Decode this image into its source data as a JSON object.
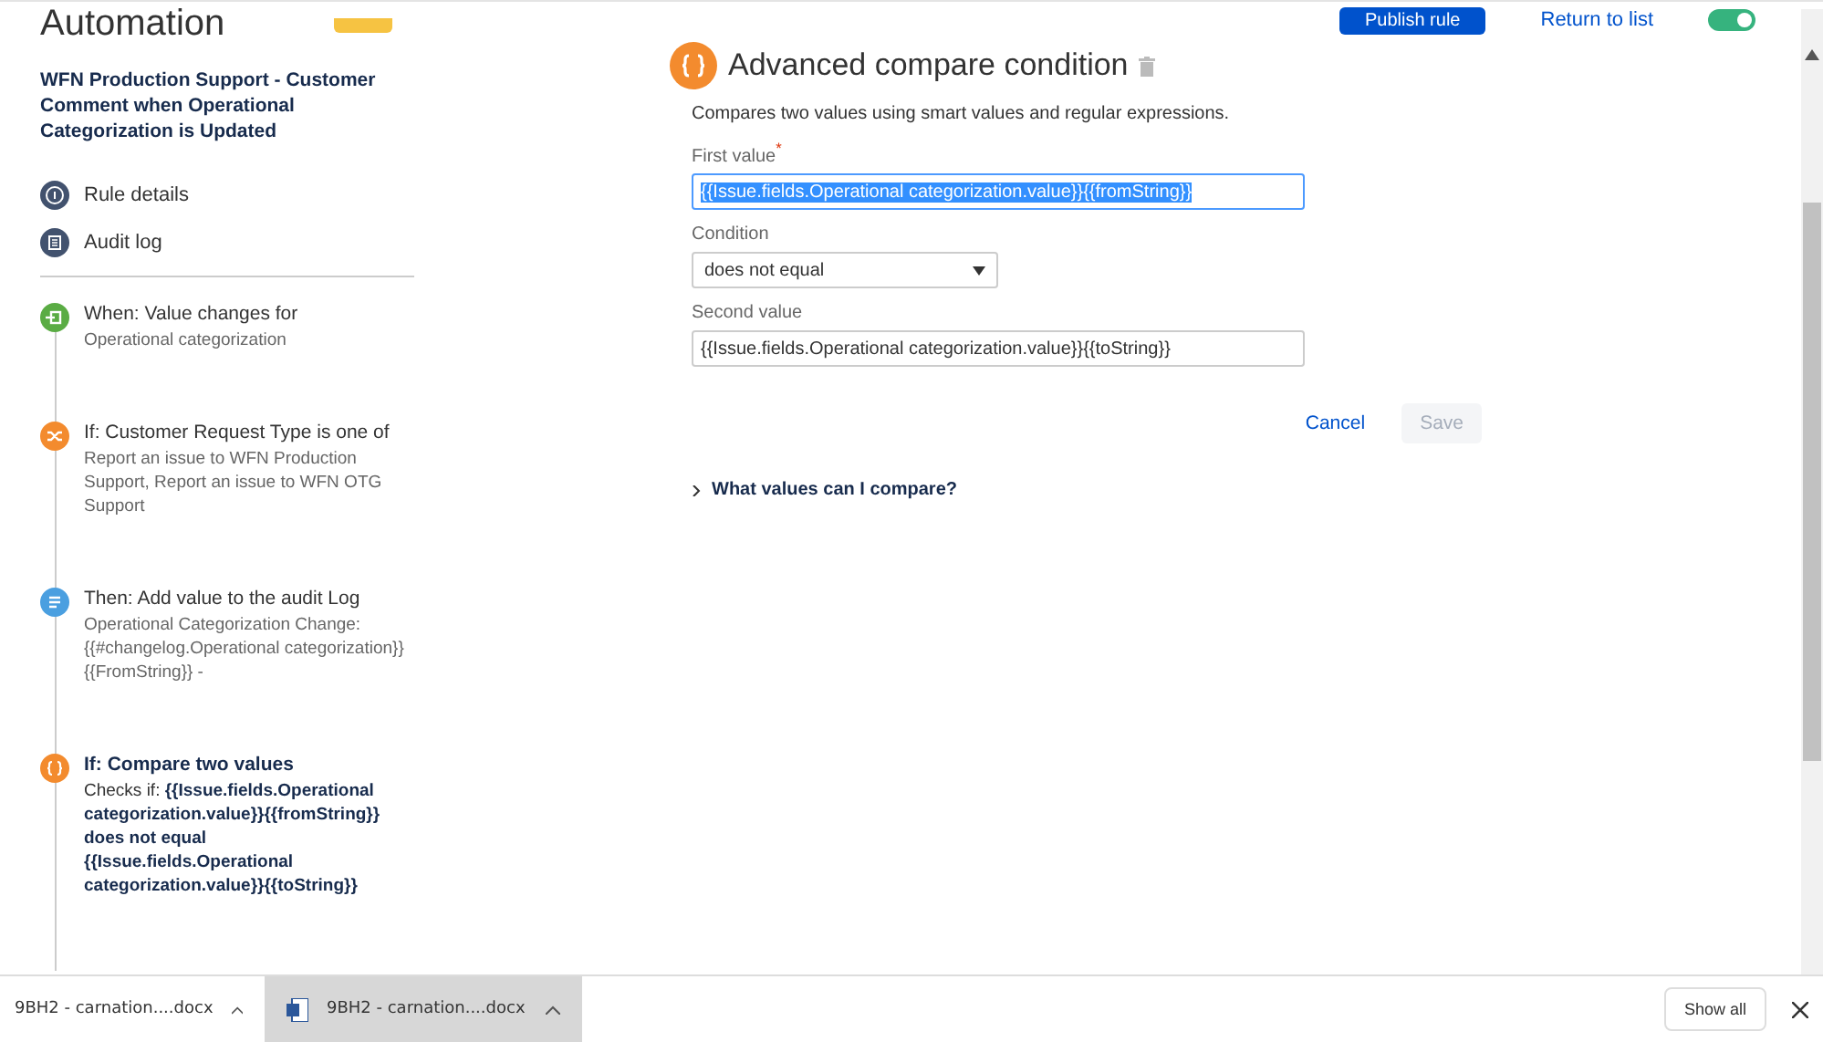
{
  "header": {
    "title": "Automation",
    "publish_button": "Publish rule",
    "return_link": "Return to list",
    "enabled": true
  },
  "rule": {
    "title": "WFN Production Support - Customer Comment when Operational Categorization is Updated"
  },
  "sidebar_links": [
    {
      "kind": "info",
      "label": "Rule details"
    },
    {
      "kind": "log",
      "label": "Audit log"
    }
  ],
  "steps": [
    {
      "kind": "trigger",
      "title": "When: Value changes for",
      "description": "Operational categorization",
      "selected": false
    },
    {
      "kind": "branch",
      "title": "If: Customer Request Type is one of",
      "description": "Report an issue to WFN Production Support, Report an issue to WFN OTG Support",
      "selected": false
    },
    {
      "kind": "action",
      "title": "Then: Add value to the audit Log",
      "description": "Operational Categorization Change: {{#changelog.Operational categorization}}{{FromString}} -",
      "selected": false
    },
    {
      "kind": "compare",
      "title": "If: Compare two values",
      "description": "Checks if: **{{Issue.fields.Operational categorization.value}}{{fromString}} does not equal {{Issue.fields.Operational categorization.value}}{{toString}}**",
      "selected": true
    }
  ],
  "panel": {
    "title": "Advanced compare condition",
    "description": "Compares two values using smart values and regular expressions.",
    "first_value": {
      "label": "First value",
      "required": true,
      "required_mark": "*",
      "value": "{{Issue.fields.Operational categorization.value}}{{fromString}}"
    },
    "condition": {
      "label": "Condition",
      "value": "does not equal"
    },
    "second_value": {
      "label": "Second value",
      "value": "{{Issue.fields.Operational categorization.value}}{{toString}}"
    },
    "cancel": "Cancel",
    "save": {
      "label": "Save",
      "disabled": true
    },
    "help": "What values can I compare?"
  },
  "downloads": [
    {
      "name": "9BH2 - carnation....docx",
      "selected": false,
      "icon": false
    },
    {
      "name": "9BH2 - carnation....docx",
      "selected": true,
      "icon": true
    }
  ],
  "download_bar": {
    "show_all": "Show all"
  }
}
